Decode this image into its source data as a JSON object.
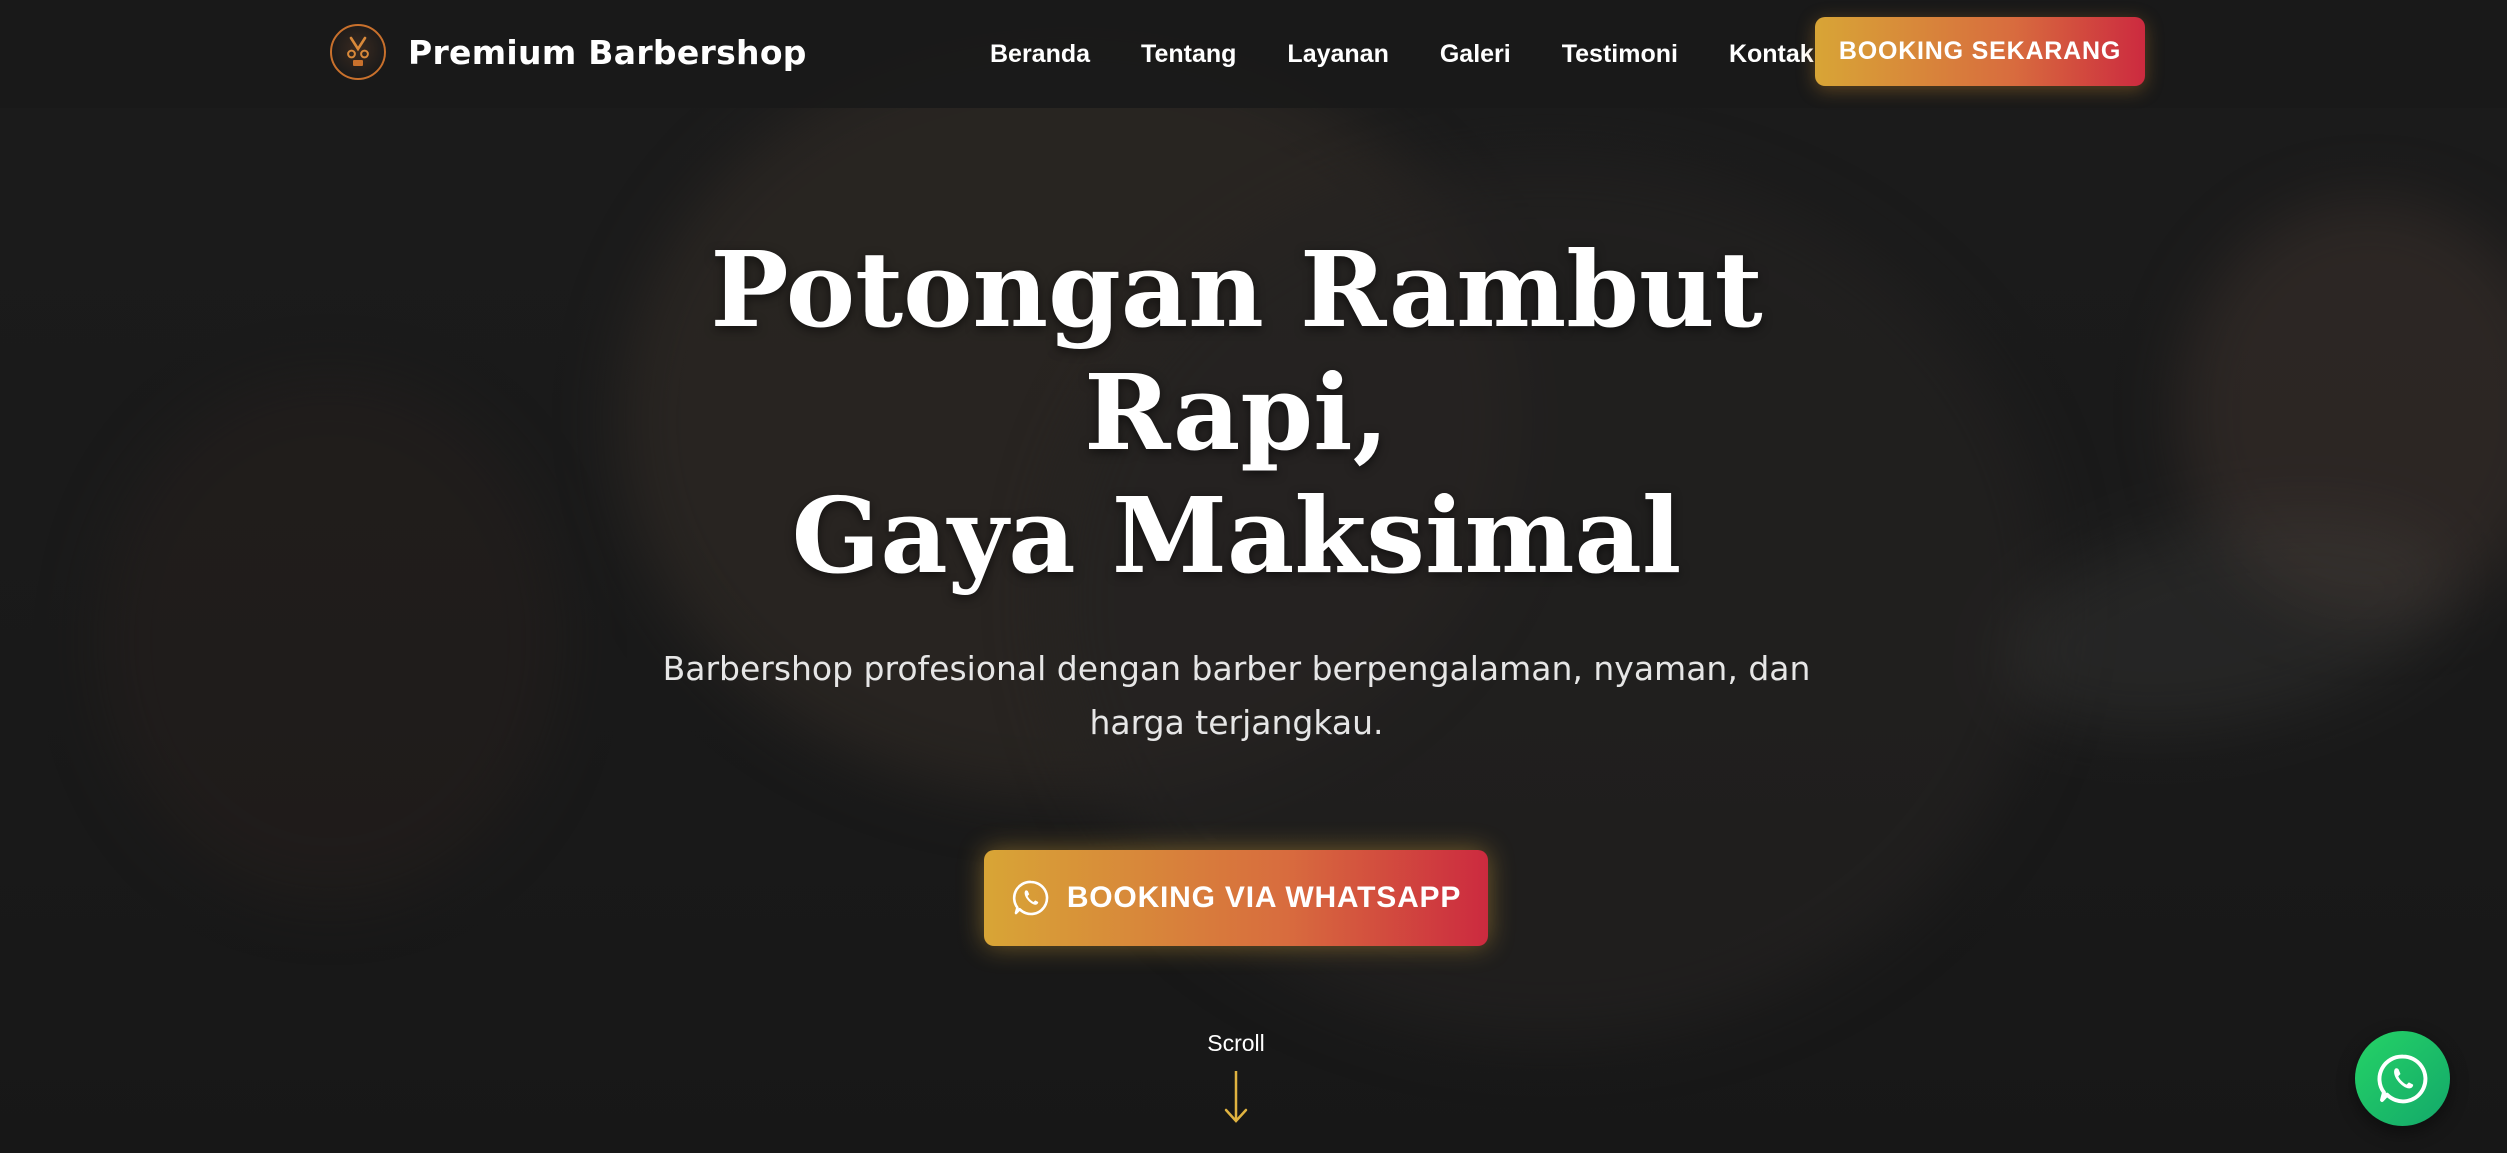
{
  "brand": {
    "name": "Premium Barbershop",
    "logo_icon": "barber-logo-icon"
  },
  "nav": {
    "links": [
      "Beranda",
      "Tentang",
      "Layanan",
      "Galeri",
      "Testimoni",
      "Kontak"
    ],
    "cta_label": "BOOKING SEKARANG"
  },
  "hero": {
    "title_lines": [
      "Potongan Rambut",
      "Rapi,",
      "Gaya Maksimal"
    ],
    "subtitle": "Barbershop profesional dengan barber berpengalaman, nyaman, dan harga terjangkau.",
    "cta_label": "BOOKING VIA WHATSAPP",
    "cta_icon": "whatsapp-icon"
  },
  "scroll": {
    "label": "Scroll",
    "icon": "arrow-down-icon"
  },
  "floating": {
    "icon": "whatsapp-icon"
  },
  "colors": {
    "gradient_start": "#d8a536",
    "gradient_end": "#cc2a3f",
    "accent_gold": "#e0b340",
    "whatsapp_green": "#25d366",
    "background": "#1c1c1c"
  }
}
